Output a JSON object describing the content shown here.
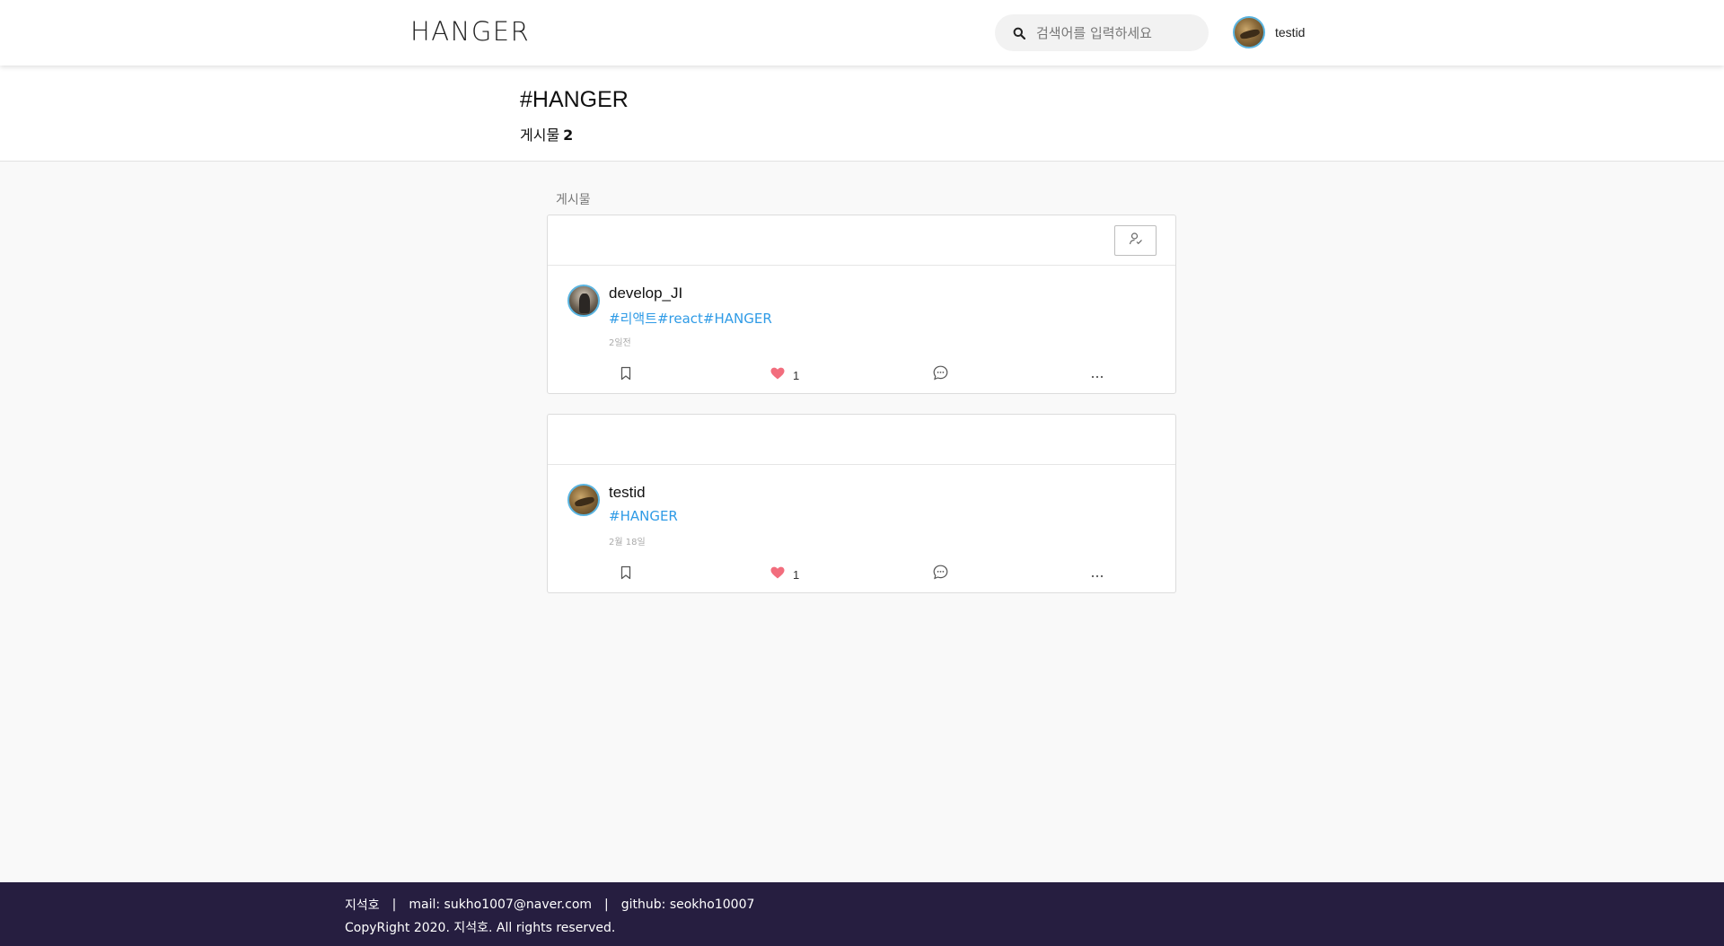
{
  "header": {
    "logo": "HANGER",
    "search_placeholder": "검색어를 입력하세요",
    "username": "testid"
  },
  "banner": {
    "tag_title": "#HANGER",
    "post_count_label": "게시물",
    "post_count": "2"
  },
  "posts_section": {
    "label": "게시물"
  },
  "posts": [
    {
      "author": "develop_JI",
      "tags": "#리액트#react#HANGER",
      "time": "2일전",
      "likes": "1",
      "has_follow_button": true
    },
    {
      "author": "testid",
      "tags": "#HANGER",
      "time": "2월 18일",
      "likes": "1",
      "has_follow_button": false
    }
  ],
  "footer": {
    "name": "지석호",
    "separator": "|",
    "mail": "mail: sukho1007@naver.com",
    "github": "github: seokho10007",
    "copyright": "CopyRight 2020. 지석호. All rights reserved."
  },
  "colors": {
    "accent_link": "#2f9be6",
    "like_heart": "#f26d7d",
    "footer_bg": "#261e40",
    "avatar_ring": "#5ab4e0"
  },
  "icons": {
    "search": "search-icon",
    "follow": "user-check-icon",
    "bookmark": "bookmark-icon",
    "like": "heart-icon",
    "comment": "comment-icon",
    "more": "more-icon"
  }
}
